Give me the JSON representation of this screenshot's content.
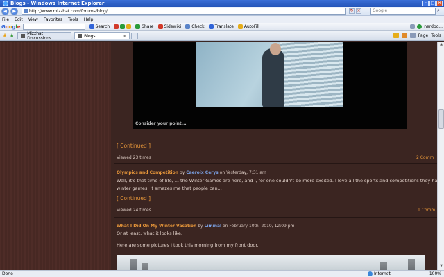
{
  "window": {
    "title": "Blogs - Windows Internet Explorer"
  },
  "address": {
    "url": "http://www.mizzhat.com/forums/blog/",
    "search_placeholder": "Google"
  },
  "menu": [
    "File",
    "Edit",
    "View",
    "Favorites",
    "Tools",
    "Help"
  ],
  "toolbar": {
    "search_label": "Search",
    "share_label": "Share",
    "sidewiki_label": "Sidewiki",
    "check_label": "Check",
    "translate_label": "Translate",
    "autofill_label": "AutoFill",
    "account_label": "nerdbo..."
  },
  "tabs": [
    {
      "label": "Mizzhat Discussions"
    },
    {
      "label": "Blogs"
    }
  ],
  "commandbar": {
    "page_label": "Page",
    "tools_label": "Tools"
  },
  "post1": {
    "image_caption": "Consider your point...",
    "continued": "[ Continued ]",
    "viewed": "Viewed 23 times",
    "comments": "2 Comm"
  },
  "post2": {
    "title": "Olympics and Competition",
    "by": "by",
    "author": "Caeroix Cerys",
    "date": "on Yesterday, 7:31 am",
    "text_line1": "Well, it's that time of life, ... the Winter Games are here, and I, for one couldn't be more excited. I love all the sports and competitions they have at the",
    "text_line2": "winter games. It amazes me that people can...",
    "continued": "[ Continued ]",
    "viewed": "Viewed 24 times",
    "comments": "1 Comm"
  },
  "post3": {
    "title": "What I Did On My Winter Vacation",
    "by": "by",
    "author": "Liminal",
    "date": "on February 10th, 2010, 12:09 pm",
    "text_line1": "Or at least, what it looks like.",
    "text_line2": "Here are some pictures I took this morning from my front door."
  },
  "status": {
    "left": "Done",
    "zone": "Internet",
    "zoom": "100%"
  }
}
